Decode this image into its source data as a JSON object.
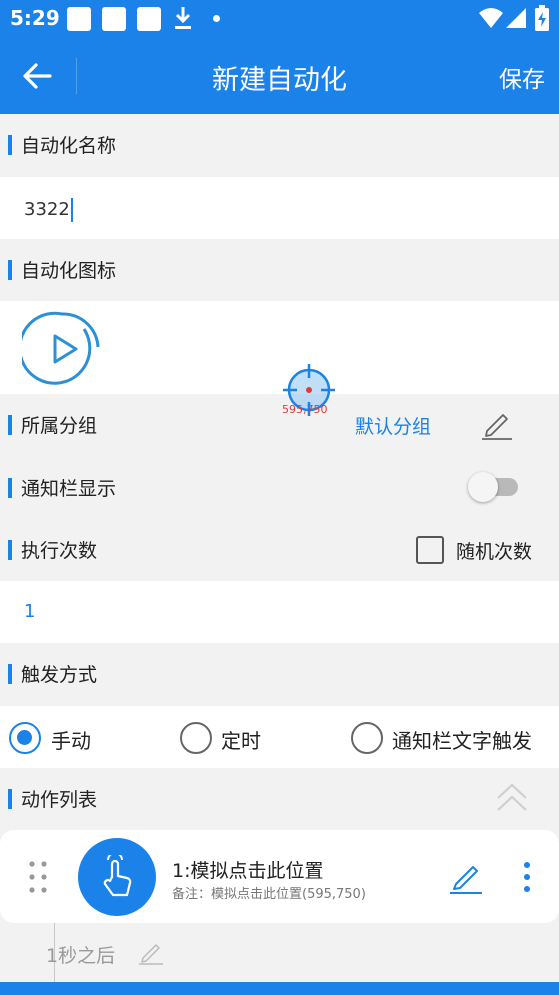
{
  "status_bar": {
    "time": "5:29",
    "icons": [
      "notification-square-icon",
      "notification-square-icon",
      "notification-square-icon",
      "download-icon",
      "dot-icon",
      "wifi-icon",
      "signal-icon",
      "battery-icon"
    ]
  },
  "app_bar": {
    "back_icon": "arrow-left-icon",
    "title": "新建自动化",
    "save_label": "保存"
  },
  "sections": {
    "name": {
      "title": "自动化名称",
      "value": "3322"
    },
    "icon": {
      "title": "自动化图标",
      "icon": "play-circle-icon"
    },
    "group": {
      "title": "所属分组",
      "value": "默认分组",
      "edit_icon": "pencil-icon"
    },
    "notification": {
      "title": "通知栏显示",
      "toggle_on": false
    },
    "count": {
      "title": "执行次数",
      "random_label": "随机次数",
      "random_checked": false,
      "value": "1"
    },
    "trigger": {
      "title": "触发方式",
      "options": [
        {
          "label": "手动",
          "selected": true
        },
        {
          "label": "定时",
          "selected": false
        },
        {
          "label": "通知栏文字触发",
          "selected": false
        }
      ]
    },
    "actions": {
      "title": "动作列表",
      "collapse_icon": "double-chevron-up-icon",
      "items": [
        {
          "title": "1:模拟点击此位置",
          "note": "备注：模拟点击此位置(595,750)",
          "icon": "tap-hand-icon",
          "delay": "1秒之后"
        }
      ]
    }
  },
  "overlay": {
    "target_label": "595,750",
    "icon": "crosshair-target-icon"
  },
  "colors": {
    "primary": "#1a82e8",
    "background": "#f2f2f2",
    "target": "#e53935"
  }
}
